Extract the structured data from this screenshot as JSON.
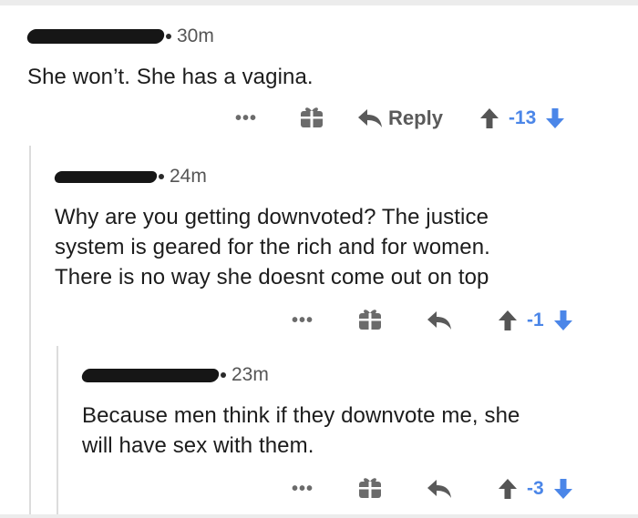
{
  "comments": [
    {
      "time": "30m",
      "body": "She won’t. She has a vagina.",
      "actions": {
        "more": "•••",
        "reply_label": "Reply",
        "score": "-13"
      }
    },
    {
      "time": "24m",
      "body": "Why are you getting downvoted? The justice\nsystem is geared for the rich and for women.\nThere is no way she doesnt come out on top",
      "actions": {
        "more": "•••",
        "score": "-1"
      }
    },
    {
      "time": "23m",
      "body": "Because men think if they downvote me, she\nwill have sex with them.",
      "actions": {
        "more": "•••",
        "score": "-3"
      }
    }
  ],
  "colors": {
    "accent": "#4b86e8",
    "icon": "#6b6b6b",
    "thread_line": "#dcdcdc"
  }
}
